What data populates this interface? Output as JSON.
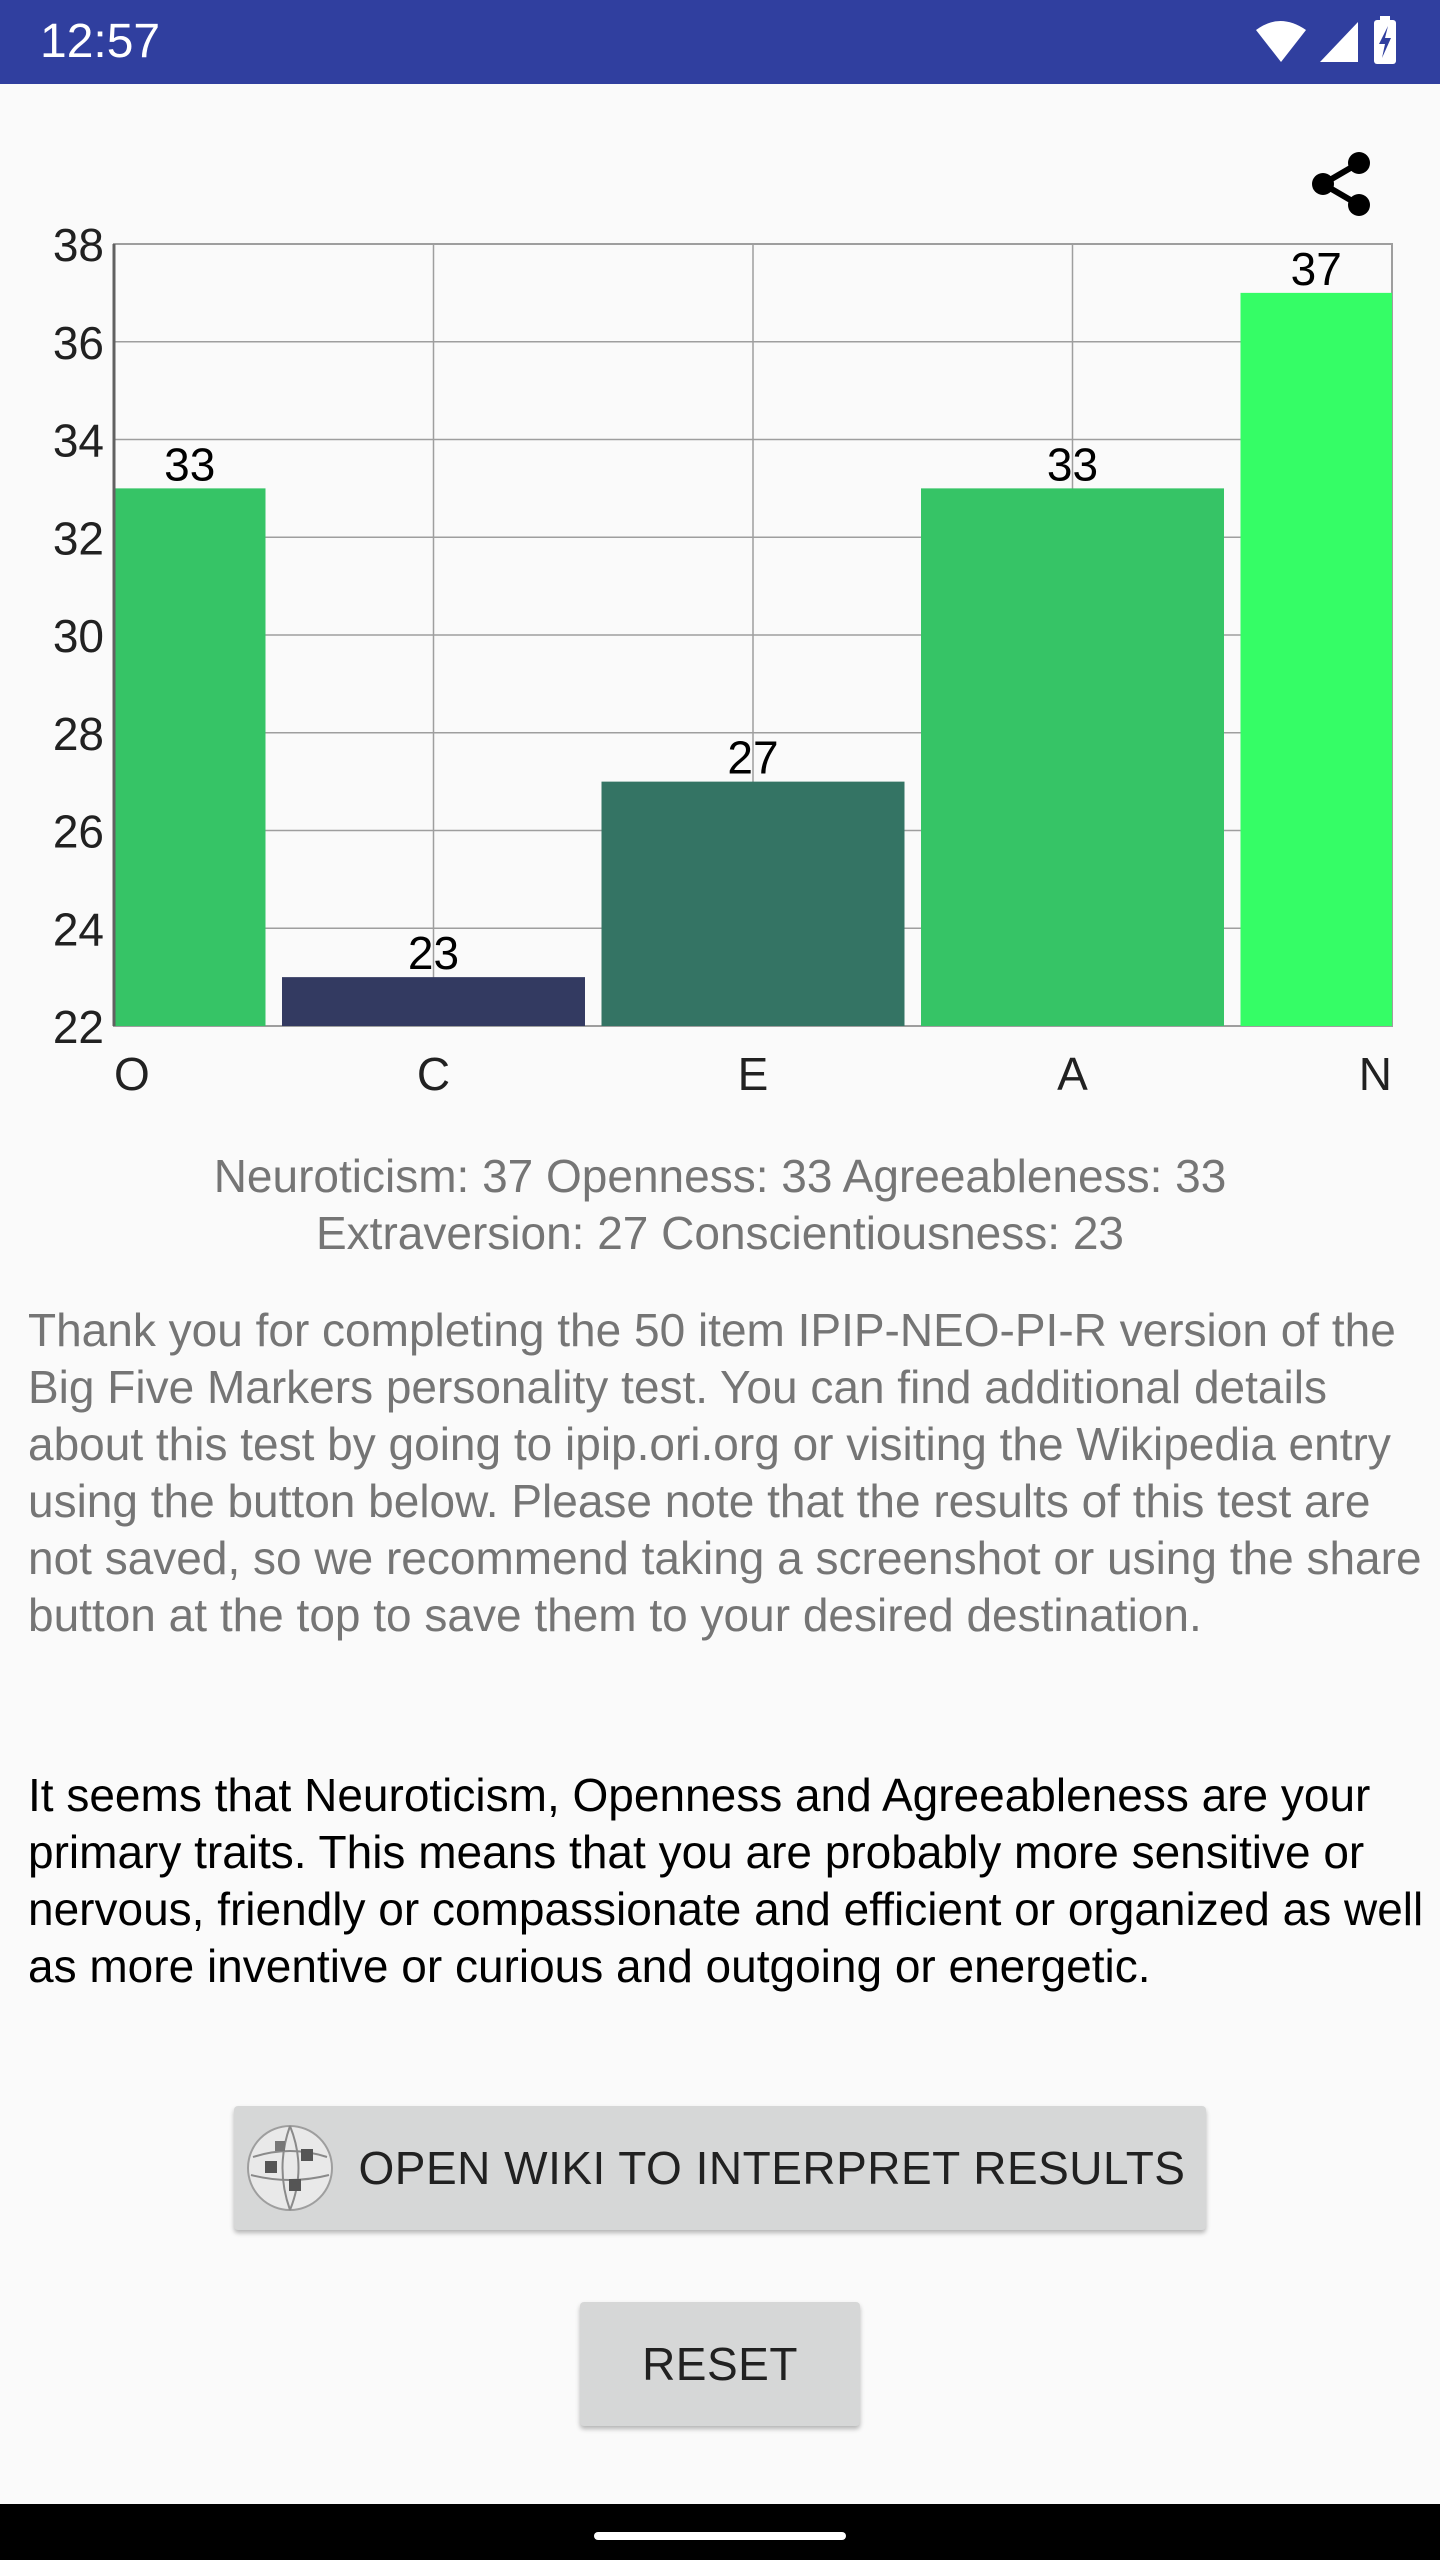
{
  "status_bar": {
    "time": "12:57",
    "icons": [
      "wifi-icon",
      "cellular-signal-icon",
      "battery-charging-icon"
    ],
    "background": "#303f9f"
  },
  "toolbar": {
    "share_icon": "share-icon"
  },
  "chart_data": {
    "type": "bar",
    "categories": [
      "O",
      "C",
      "E",
      "A",
      "N"
    ],
    "values": [
      33,
      23,
      27,
      33,
      37
    ],
    "data_labels": [
      "33",
      "23",
      "27",
      "33",
      "37"
    ],
    "bar_colors": [
      "#36c466",
      "#333a61",
      "#347464",
      "#36c466",
      "#35fd66"
    ],
    "y_ticks": [
      "22",
      "24",
      "26",
      "28",
      "30",
      "32",
      "34",
      "36",
      "38"
    ],
    "ylim": [
      22,
      38
    ],
    "grid": true,
    "legend": "none",
    "title": "",
    "xlabel": "",
    "ylabel": ""
  },
  "summary": {
    "line1": "Neuroticism: 37  Openness: 33  Agreeableness: 33",
    "line2": "Extraversion: 27  Conscientiousness: 23"
  },
  "intro_text": "Thank you for completing the 50 item IPIP-NEO-PI-R version of the Big Five Markers personality test. You can find additional details about this test by going to ipip.ori.org or visiting the Wikipedia entry using the button below. Please note that the results of this test are not saved, so we recommend taking a screenshot or using the share button at the top to save them to your desired destination.",
  "analysis_text": "It seems that Neuroticism, Openness and Agreeableness are your primary traits. This means that you are probably more sensitive or nervous, friendly or compassionate and efficient or organized as well as more inventive or curious and outgoing or energetic.",
  "buttons": {
    "wiki_label": "OPEN WIKI TO INTERPRET RESULTS",
    "wiki_icon": "wikipedia-globe-icon",
    "reset_label": "RESET"
  }
}
